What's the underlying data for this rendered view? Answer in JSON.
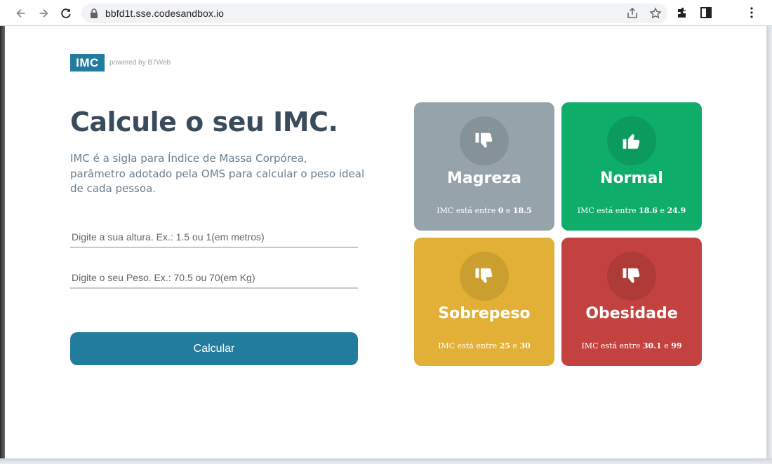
{
  "browser": {
    "url": "bbfd1t.sse.codesandbox.io"
  },
  "logo": {
    "mark": "IMC",
    "subtitle": "powered by B7Web"
  },
  "main": {
    "title": "Calcule o seu IMC.",
    "description": "IMC é a sigla para Índice de Massa Corpórea, parâmetro adotado pela OMS para calcular o peso ideal de cada pessoa.",
    "height_placeholder": "Digite a sua altura. Ex.: 1.5 ou 1(em metros)",
    "weight_placeholder": "Digite o seu Peso. Ex.: 70.5 ou 70(em Kg)",
    "calc_label": "Calcular"
  },
  "levels": [
    {
      "title": "Magreza",
      "range_prefix": "IMC está entre",
      "min": "0",
      "and": "e",
      "max": "18.5",
      "color": "#96a3ab",
      "icon": "thumbs-down-icon"
    },
    {
      "title": "Normal",
      "range_prefix": "IMC está entre",
      "min": "18.6",
      "and": "e",
      "max": "24.9",
      "color": "#0ead69",
      "icon": "thumbs-up-icon"
    },
    {
      "title": "Sobrepeso",
      "range_prefix": "IMC está entre",
      "min": "25",
      "and": "e",
      "max": "30",
      "color": "#e2b036",
      "icon": "thumbs-down-icon"
    },
    {
      "title": "Obesidade",
      "range_prefix": "IMC está entre",
      "min": "30.1",
      "and": "e",
      "max": "99",
      "color": "#c3423f",
      "icon": "thumbs-down-icon"
    }
  ]
}
